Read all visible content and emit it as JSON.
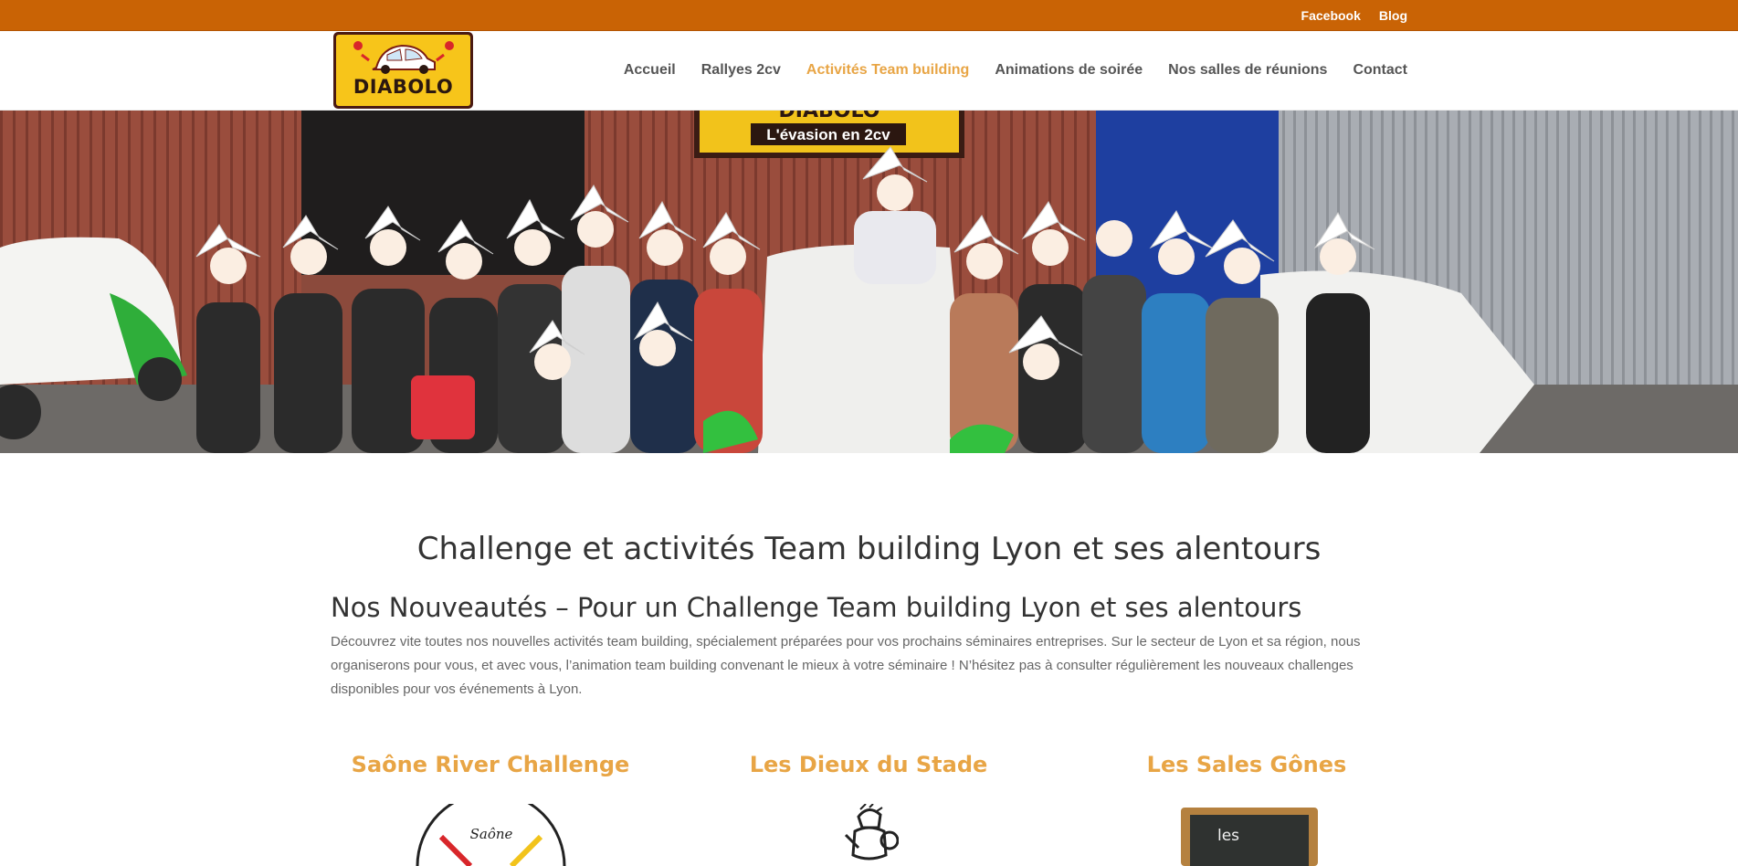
{
  "topbar": {
    "links": [
      "Facebook",
      "Blog"
    ]
  },
  "logo": {
    "text": "DIABOLO"
  },
  "nav": {
    "items": [
      {
        "label": "Accueil",
        "active": false
      },
      {
        "label": "Rallyes 2cv",
        "active": false
      },
      {
        "label": "Activités Team building",
        "active": true
      },
      {
        "label": "Animations de soirée",
        "active": false
      },
      {
        "label": "Nos salles de réunions",
        "active": false
      },
      {
        "label": "Contact",
        "active": false
      }
    ]
  },
  "hero": {
    "sign_top": "DIABOLO",
    "sign_bottom": "L'évasion en 2cv"
  },
  "content": {
    "main_title": "Challenge et activités Team building Lyon et ses alentours",
    "sub_title": "Nos Nouveautés – Pour un Challenge Team building Lyon et ses alentours",
    "intro": "Découvrez vite toutes nos nouvelles activités team building, spécialement préparées pour vos prochains séminaires entreprises. Sur le secteur de Lyon et sa région, nous organiserons pour vous, et avec vous, l’animation team building  convenant le mieux à votre séminaire ! N’hésitez pas à consulter régulièrement les nouveaux challenges disponibles pour vos événements à Lyon."
  },
  "columns": [
    {
      "title": "Saône River Challenge",
      "image_text": "Saône"
    },
    {
      "title": "Les Dieux du Stade",
      "image_text": ""
    },
    {
      "title": "Les Sales Gônes",
      "image_text": "les"
    }
  ],
  "colors": {
    "topbar": "#c96305",
    "accent": "#e8a545",
    "logo_yellow": "#f7c51a"
  }
}
